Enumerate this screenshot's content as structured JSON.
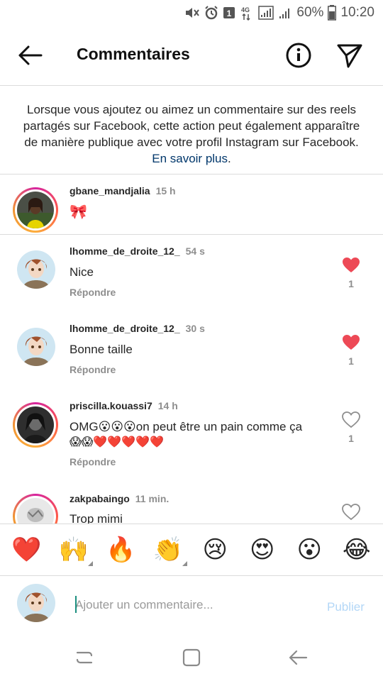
{
  "status_bar": {
    "battery": "60%",
    "time": "10:20",
    "sim_badge": "1",
    "network": "4G"
  },
  "header": {
    "title": "Commentaires"
  },
  "notice": {
    "text": "Lorsque vous ajoutez ou aimez un commentaire sur des reels partagés sur Facebook, cette action peut également apparaître de manière publique avec votre profil Instagram sur Facebook.",
    "link": "En savoir plus",
    "end": "."
  },
  "comments": [
    {
      "username": "gbane_mandjalia",
      "time": "15 h",
      "text": "🎀",
      "reply": "",
      "likes": "",
      "liked": false
    },
    {
      "username": "lhomme_de_droite_12_",
      "time": "54 s",
      "text": "Nice",
      "reply": "Répondre",
      "likes": "1",
      "liked": true
    },
    {
      "username": "lhomme_de_droite_12_",
      "time": "30 s",
      "text": "Bonne taille",
      "reply": "Répondre",
      "likes": "1",
      "liked": true
    },
    {
      "username": "priscilla.kouassi7",
      "time": "14 h",
      "text_line1": "OMG😮😮😮on peut être un pain comme ça",
      "text_line2": "😱😱❤️❤️❤️❤️❤️",
      "reply": "Répondre",
      "likes": "1",
      "liked": false
    },
    {
      "username": "zakpabaingo",
      "time": "11 min.",
      "text": "Trop mimi",
      "reply": "",
      "likes": "",
      "liked": false
    }
  ],
  "reactions": [
    "❤️",
    "🙌",
    "🔥",
    "👏",
    "😢",
    "😍",
    "😮",
    "😂"
  ],
  "composer": {
    "placeholder": "Ajouter un commentaire...",
    "publish_label": "Publier"
  },
  "colors": {
    "like_red": "#ed4956",
    "link_blue": "#00376b",
    "publish_disabled": "#b3d7f7",
    "muted_gray": "#8e8e8e"
  }
}
